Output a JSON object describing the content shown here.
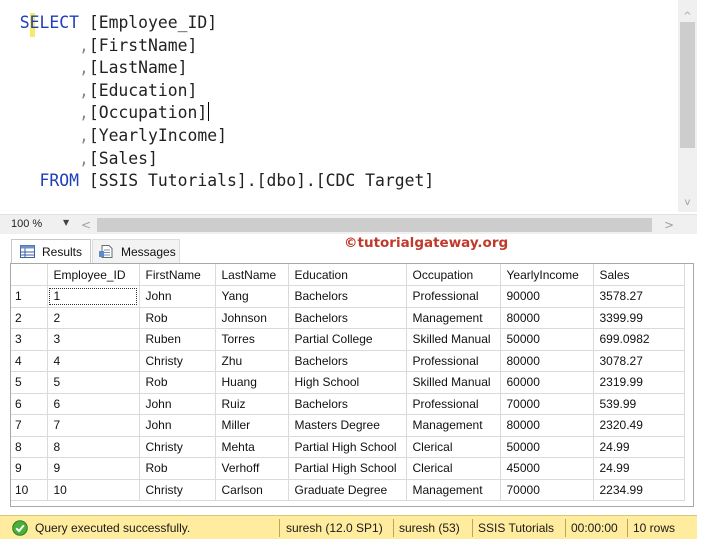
{
  "editor": {
    "lines": [
      {
        "indent": "  ",
        "kw": "SELECT",
        "rest": " [Employee_ID]",
        "cursor": false
      },
      {
        "indent": "        ",
        "kw": "",
        "comma": ",",
        "rest": "[FirstName]",
        "cursor": false
      },
      {
        "indent": "        ",
        "kw": "",
        "comma": ",",
        "rest": "[LastName]",
        "cursor": false
      },
      {
        "indent": "        ",
        "kw": "",
        "comma": ",",
        "rest": "[Education]",
        "cursor": false
      },
      {
        "indent": "        ",
        "kw": "",
        "comma": ",",
        "rest": "[Occupation]",
        "cursor": true
      },
      {
        "indent": "        ",
        "kw": "",
        "comma": ",",
        "rest": "[YearlyIncome]",
        "cursor": false
      },
      {
        "indent": "        ",
        "kw": "",
        "comma": ",",
        "rest": "[Sales]",
        "cursor": false
      },
      {
        "indent": "    ",
        "kw": "FROM",
        "rest": " [SSIS Tutorials].[dbo].[CDC Target]",
        "cursor": false
      }
    ],
    "zoom": "100 %"
  },
  "tabs": {
    "results_label": "Results",
    "messages_label": "Messages"
  },
  "watermark": "©tutorialgateway.org",
  "grid": {
    "columns": [
      "Employee_ID",
      "FirstName",
      "LastName",
      "Education",
      "Occupation",
      "YearlyIncome",
      "Sales"
    ],
    "rows": [
      [
        "1",
        "1",
        "John",
        "Yang",
        "Bachelors",
        "Professional",
        "90000",
        "3578.27"
      ],
      [
        "2",
        "2",
        "Rob",
        "Johnson",
        "Bachelors",
        "Management",
        "80000",
        "3399.99"
      ],
      [
        "3",
        "3",
        "Ruben",
        "Torres",
        "Partial College",
        "Skilled Manual",
        "50000",
        "699.0982"
      ],
      [
        "4",
        "4",
        "Christy",
        "Zhu",
        "Bachelors",
        "Professional",
        "80000",
        "3078.27"
      ],
      [
        "5",
        "5",
        "Rob",
        "Huang",
        "High School",
        "Skilled Manual",
        "60000",
        "2319.99"
      ],
      [
        "6",
        "6",
        "John",
        "Ruiz",
        "Bachelors",
        "Professional",
        "70000",
        "539.99"
      ],
      [
        "7",
        "7",
        "John",
        "Miller",
        "Masters Degree",
        "Management",
        "80000",
        "2320.49"
      ],
      [
        "8",
        "8",
        "Christy",
        "Mehta",
        "Partial High School",
        "Clerical",
        "50000",
        "24.99"
      ],
      [
        "9",
        "9",
        "Rob",
        "Verhoff",
        "Partial High School",
        "Clerical",
        "45000",
        "24.99"
      ],
      [
        "10",
        "10",
        "Christy",
        "Carlson",
        "Graduate Degree",
        "Management",
        "70000",
        "2234.99"
      ]
    ]
  },
  "status": {
    "message": "Query executed successfully.",
    "server": "suresh (12.0 SP1)",
    "user": "suresh (53)",
    "database": "SSIS Tutorials",
    "elapsed": "00:00:00",
    "rows": "10 rows"
  },
  "colors": {
    "keyword": "#1f3fb8",
    "status_bar": "#ffec9e",
    "watermark": "#c0392b"
  },
  "icons": {
    "results_tab": "grid-icon",
    "messages_tab": "document-icon",
    "status": "check-circle-icon"
  }
}
